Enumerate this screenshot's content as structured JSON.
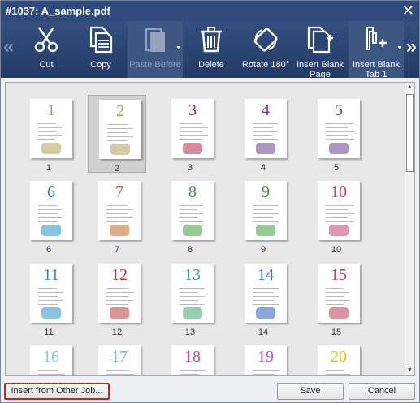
{
  "window": {
    "title": "#1037: A_sample.pdf",
    "close_glyph": "✕"
  },
  "toolbar": {
    "nav_left": "«",
    "nav_right": "»",
    "items": [
      {
        "label": "Cut",
        "icon": "scissors-icon",
        "enabled": true
      },
      {
        "label": "Copy",
        "icon": "copy-icon",
        "enabled": true
      },
      {
        "label": "Paste Before",
        "icon": "paste-icon",
        "enabled": false,
        "dropdown": true
      },
      {
        "label": "Delete",
        "icon": "trash-icon",
        "enabled": true
      },
      {
        "label": "Rotate 180°",
        "icon": "rotate-icon",
        "enabled": true
      },
      {
        "label": "Insert Blank Page",
        "icon": "insert-page-icon",
        "enabled": true
      },
      {
        "label": "Insert Blank Tab 1",
        "icon": "insert-tab-icon",
        "enabled": true,
        "dropdown": true
      }
    ]
  },
  "pages": [
    {
      "label": "1",
      "num": "1",
      "color": "#b3a15a",
      "selected": false
    },
    {
      "label": "2",
      "num": "2",
      "color": "#b3a15a",
      "selected": true
    },
    {
      "label": "3",
      "num": "3",
      "color": "#b52b47",
      "selected": false
    },
    {
      "label": "4",
      "num": "4",
      "color": "#6b3f8f",
      "selected": false
    },
    {
      "label": "5",
      "num": "5",
      "color": "#6b3f8f",
      "selected": false
    },
    {
      "label": "6",
      "num": "6",
      "color": "#2a8fc9",
      "selected": false
    },
    {
      "label": "7",
      "num": "7",
      "color": "#c8672a",
      "selected": false
    },
    {
      "label": "8",
      "num": "8",
      "color": "#3f9c3a",
      "selected": false
    },
    {
      "label": "9",
      "num": "9",
      "color": "#3f9c3a",
      "selected": false
    },
    {
      "label": "10",
      "num": "10",
      "color": "#c2416b",
      "selected": false
    },
    {
      "label": "11",
      "num": "11",
      "color": "#2a8fc9",
      "selected": false
    },
    {
      "label": "12",
      "num": "12",
      "color": "#c23b3b",
      "selected": false
    },
    {
      "label": "13",
      "num": "13",
      "color": "#3fa86b",
      "selected": false
    },
    {
      "label": "14",
      "num": "14",
      "color": "#2a5fbf",
      "selected": false
    },
    {
      "label": "15",
      "num": "15",
      "color": "#c23b5a",
      "selected": false
    },
    {
      "label": "",
      "num": "16",
      "color": "#7fd0e8",
      "selected": false
    },
    {
      "label": "",
      "num": "17",
      "color": "#5fc0e0",
      "selected": false
    },
    {
      "label": "",
      "num": "18",
      "color": "#d04a8a",
      "selected": false
    },
    {
      "label": "",
      "num": "19",
      "color": "#c04ac8",
      "selected": false
    },
    {
      "label": "",
      "num": "20",
      "color": "#d8c030",
      "selected": false
    }
  ],
  "scrollbar": {
    "up": "▲",
    "down": "▼"
  },
  "footer": {
    "insert_other": "Insert from Other Job...",
    "save": "Save",
    "cancel": "Cancel"
  }
}
